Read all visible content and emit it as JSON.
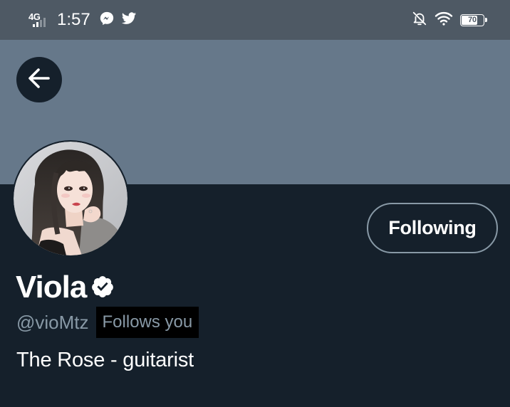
{
  "status_bar": {
    "network_type": "4G",
    "time": "1:57",
    "notification_icons": [
      "messenger-icon",
      "twitter-icon"
    ],
    "right_icons": [
      "bell-off-icon",
      "wifi-icon",
      "battery-icon"
    ],
    "battery_level": "70"
  },
  "header": {
    "back_icon": "arrow-left-icon"
  },
  "profile": {
    "display_name": "Viola",
    "verified": true,
    "handle": "@vioMtz",
    "follows_you_label": "Follows you",
    "bio": "The Rose - guitarist",
    "follow_button_label": "Following"
  },
  "colors": {
    "background": "#15202b",
    "banner": "#66788a",
    "status_bar": "#4e5964",
    "secondary_text": "#8899a6",
    "primary_text": "#ffffff"
  }
}
